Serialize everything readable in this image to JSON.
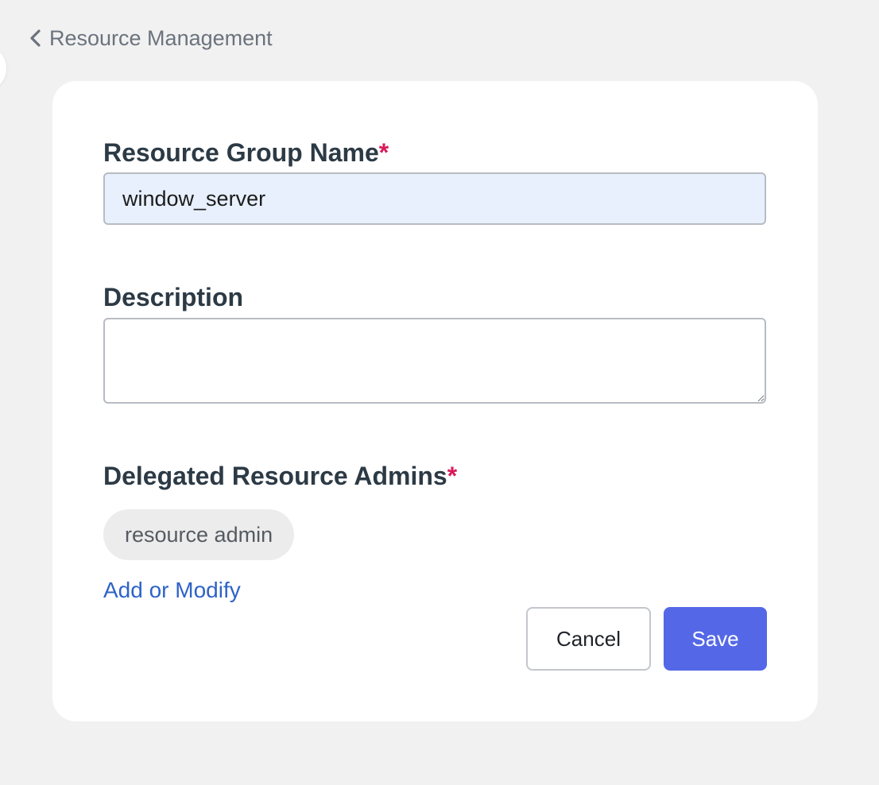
{
  "header": {
    "back_label": "Resource Management"
  },
  "form": {
    "group_name": {
      "label": "Resource Group Name",
      "required_mark": "*",
      "value": "window_server"
    },
    "description": {
      "label": "Description",
      "value": ""
    },
    "admins": {
      "label": "Delegated Resource Admins",
      "required_mark": "*",
      "chips": [
        "resource admin"
      ],
      "add_link": "Add or Modify"
    }
  },
  "actions": {
    "cancel_label": "Cancel",
    "save_label": "Save"
  },
  "colors": {
    "accent": "#5468e7",
    "link": "#2e63c8",
    "required": "#d91a5a",
    "autofill_bg": "#e8f0fe"
  },
  "icons": {
    "back": "chevron-left-icon"
  }
}
